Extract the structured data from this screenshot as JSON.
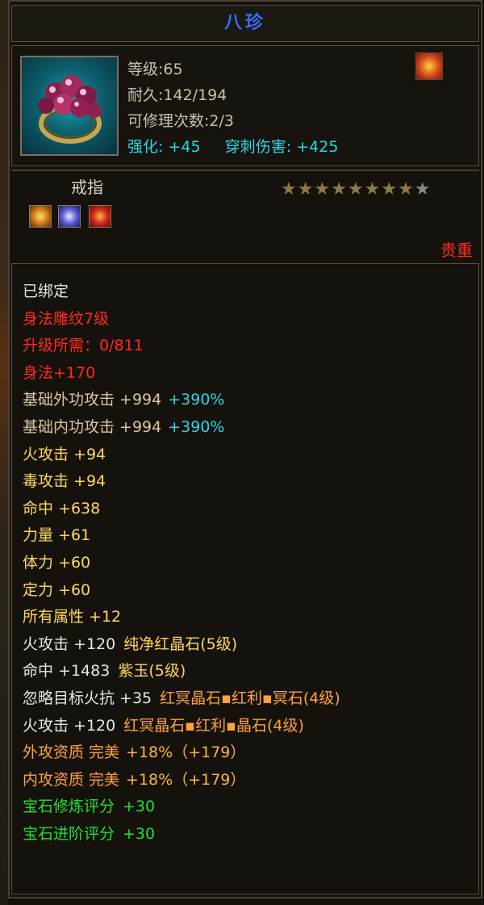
{
  "item": {
    "name": "八珍",
    "level_text": "等级:65",
    "durability_text": "耐久:142/194",
    "repair_text": "可修理次数:2/3",
    "enhance_label": "强化:",
    "enhance_value": "+45",
    "pierce_label": "穿刺伤害:",
    "pierce_value": "+425",
    "type": "戒指",
    "rarity": "贵重",
    "stars_filled": 8,
    "stars_total": 9,
    "icon": "pearl-ring-icon",
    "corner_icon": "flame-badge-icon",
    "gem_slots": [
      "sun-gem-icon",
      "moon-gem-icon",
      "fire-gem-icon"
    ]
  },
  "attributes": [
    {
      "text": "已绑定",
      "color": "#e6e6e6"
    },
    {
      "text": "身法雕纹7级",
      "color": "#ff2a1e"
    },
    {
      "text": "升级所需：0/811",
      "color": "#ff2a1e"
    },
    {
      "text": "身法+170",
      "color": "#ff2a1e"
    },
    {
      "text": "基础外功攻击 +994",
      "extra": "+390%",
      "color": "#d9c7a5"
    },
    {
      "text": "基础内功攻击 +994",
      "extra": "+390%",
      "color": "#d9c7a5"
    },
    {
      "text": "火攻击 +94",
      "color": "#ffd85a"
    },
    {
      "text": "毒攻击 +94",
      "color": "#ffd85a"
    },
    {
      "text": "命中 +638",
      "color": "#ffd85a"
    },
    {
      "text": "力量 +61",
      "color": "#ffd85a"
    },
    {
      "text": "体力 +60",
      "color": "#ffd85a"
    },
    {
      "text": "定力 +60",
      "color": "#ffd85a"
    },
    {
      "text": "所有属性 +12",
      "color": "#ffd85a"
    },
    {
      "text": "火攻击 +120",
      "gem": "纯净红晶石(5级)",
      "color": "#e6e6e6",
      "gem_color": "#ffd85a"
    },
    {
      "text": "命中 +1483",
      "gem": "紫玉(5级)",
      "color": "#e6e6e6",
      "gem_color": "#ffd85a"
    },
    {
      "text": "忽略目标火抗 +35",
      "gem": "红冥晶石▪红利▪冥石(4级)",
      "color": "#e6e6e6",
      "gem_color": "#ffa23a"
    },
    {
      "text": "火攻击 +120",
      "gem": "红冥晶石▪红利▪晶石(4级)",
      "color": "#e6e6e6",
      "gem_color": "#ffa23a"
    },
    {
      "text": "外攻资质  完美",
      "extra2": "+18%（+179）",
      "color": "#ffa23a",
      "extra2_color": "#ffb43a"
    },
    {
      "text": "内攻资质  完美",
      "extra2": "+18%（+179）",
      "color": "#ffa23a",
      "extra2_color": "#ffb43a"
    },
    {
      "text": "宝石修炼评分",
      "extra3": "+30",
      "color": "#22e02a"
    },
    {
      "text": "宝石进阶评分",
      "extra3": "+30",
      "color": "#22e02a"
    }
  ]
}
